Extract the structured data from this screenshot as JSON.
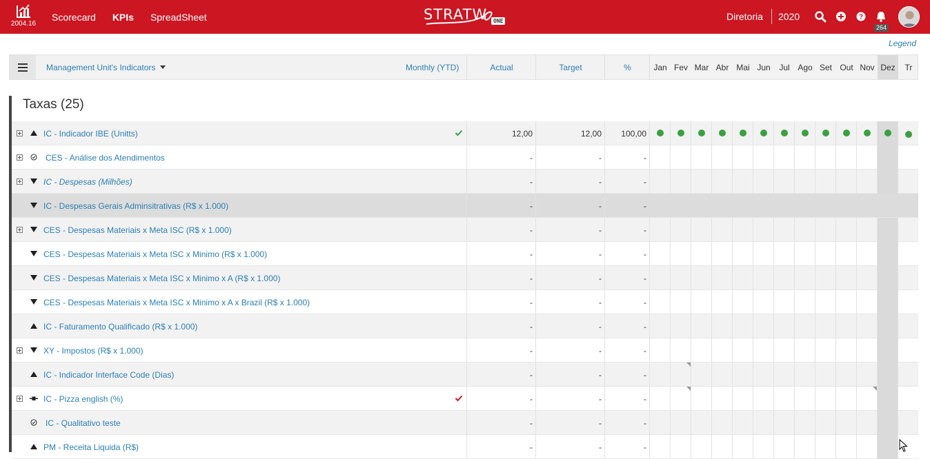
{
  "app": {
    "version": "2004.16",
    "brand": "STRATW",
    "brand_suffix": "ONE",
    "nav": [
      {
        "label": "Scorecard",
        "active": false
      },
      {
        "label": "KPIs",
        "active": true
      },
      {
        "label": "SpreadSheet",
        "active": false
      }
    ],
    "org": "Diretoria",
    "year": "2020",
    "notifications": "264",
    "icons": [
      "search-icon",
      "add-circle-icon",
      "help-icon",
      "bell-icon"
    ],
    "accent": "#cc1622"
  },
  "legend_label": "Legend",
  "header": {
    "dropdown_label": "Management Unit's Indicators",
    "period": "Monthly (YTD)",
    "actual": "Actual",
    "target": "Target",
    "percent": "%",
    "months": [
      "Jan",
      "Fev",
      "Mar",
      "Abr",
      "Mai",
      "Jun",
      "Jul",
      "Ago",
      "Set",
      "Out",
      "Nov",
      "Dez",
      "Tr"
    ],
    "current_month": "Dez"
  },
  "group": {
    "title": "Taxas (25)"
  },
  "rows": [
    {
      "name": "IC - Indicador IBE (Unitts)",
      "expand": true,
      "direction": "up",
      "italic": false,
      "check": "green",
      "actual": "12,00",
      "target": "12,00",
      "percent": "100,00",
      "dots": true
    },
    {
      "name": "CES - Análise dos Atendimentos",
      "expand": true,
      "direction": "qualitative",
      "italic": false,
      "check": "",
      "actual": "-",
      "target": "-",
      "percent": "-",
      "dots": false
    },
    {
      "name": "IC - Despesas (Milhões)",
      "expand": true,
      "direction": "down",
      "italic": true,
      "check": "",
      "actual": "-",
      "target": "-",
      "percent": "-",
      "dots": false
    },
    {
      "name": "IC - Despesas Gerais Adminsitrativas (R$ x 1.000)",
      "expand": false,
      "direction": "down",
      "italic": false,
      "check": "",
      "actual": "-",
      "target": "-",
      "percent": "-",
      "dots": false,
      "selected": true
    },
    {
      "name": "CES - Despesas Materiais x Meta ISC (R$ x 1.000)",
      "expand": true,
      "direction": "down",
      "italic": false,
      "check": "",
      "actual": "-",
      "target": "-",
      "percent": "-",
      "dots": false
    },
    {
      "name": "CES - Despesas Materiais x Meta ISC x Minimo (R$ x 1.000)",
      "expand": false,
      "direction": "down",
      "italic": false,
      "check": "",
      "actual": "-",
      "target": "-",
      "percent": "-",
      "dots": false
    },
    {
      "name": "CES - Despesas Materiais x Meta ISC x Minimo x A (R$ x 1.000)",
      "expand": false,
      "direction": "down",
      "italic": false,
      "check": "",
      "actual": "-",
      "target": "-",
      "percent": "-",
      "dots": false
    },
    {
      "name": "CES - Despesas Materiais x Meta ISC x Minimo x A x Brazil (R$ x 1.000)",
      "expand": false,
      "direction": "down",
      "italic": false,
      "check": "",
      "actual": "-",
      "target": "-",
      "percent": "-",
      "dots": false
    },
    {
      "name": "IC - Faturamento Qualificado (R$ x 1.000)",
      "expand": false,
      "direction": "up",
      "italic": false,
      "check": "",
      "actual": "-",
      "target": "-",
      "percent": "-",
      "dots": false
    },
    {
      "name": "XY - Impostos (R$ x 1.000)",
      "expand": true,
      "direction": "down",
      "italic": false,
      "check": "",
      "actual": "-",
      "target": "-",
      "percent": "-",
      "dots": false
    },
    {
      "name": "IC - Indicador Interface Code (Dias)",
      "expand": false,
      "direction": "up",
      "italic": false,
      "check": "",
      "actual": "-",
      "target": "-",
      "percent": "-",
      "dots": false,
      "flag_month": 1
    },
    {
      "name": "IC - Pizza english (%)",
      "expand": true,
      "direction": "target",
      "italic": false,
      "check": "red",
      "actual": "-",
      "target": "-",
      "percent": "-",
      "dots": false,
      "flag_month": 1,
      "flag_month2": 10
    },
    {
      "name": "IC - Qualitativo teste",
      "expand": false,
      "direction": "qualitative",
      "italic": false,
      "check": "",
      "actual": "-",
      "target": "-",
      "percent": "-",
      "dots": false
    },
    {
      "name": "PM - Receita Liquida (R$)",
      "expand": false,
      "direction": "up",
      "italic": false,
      "check": "",
      "actual": "-",
      "target": "-",
      "percent": "-",
      "dots": false
    }
  ]
}
